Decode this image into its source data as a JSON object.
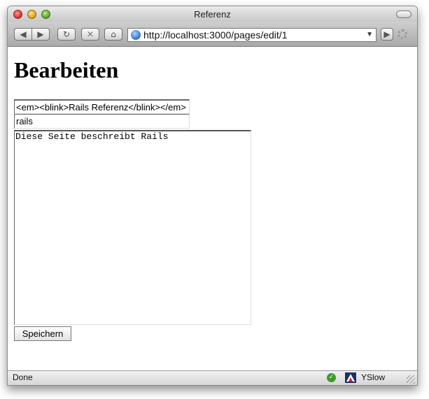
{
  "window": {
    "title": "Referenz"
  },
  "toolbar": {
    "back_icon": "back-arrow-icon",
    "forward_icon": "forward-arrow-icon",
    "reload_icon": "reload-icon",
    "stop_icon": "stop-icon",
    "home_icon": "home-icon",
    "url": "http://localhost:3000/pages/edit/1"
  },
  "page": {
    "heading": "Bearbeiten",
    "title_value": "<em><blink>Rails Referenz</blink></em>",
    "permalink_value": "rails",
    "body_value": "Diese Seite beschreibt Rails",
    "save_label": "Speichern"
  },
  "statusbar": {
    "status": "Done",
    "yslow_label": "YSlow"
  }
}
